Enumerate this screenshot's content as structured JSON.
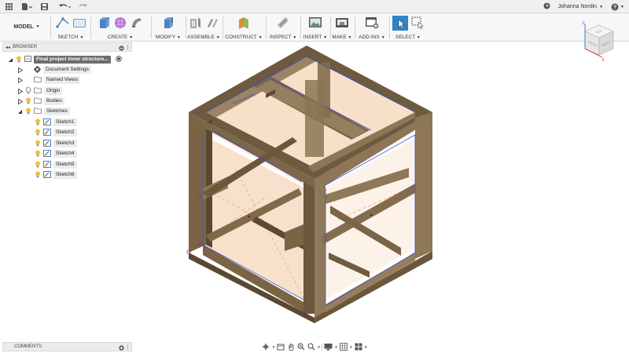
{
  "appbar": {
    "username": "Johanna Nordin",
    "icons": [
      "grid-icon",
      "file-icon",
      "save-icon",
      "undo-icon",
      "redo-icon",
      "clock-icon",
      "help-icon"
    ]
  },
  "toolbar": {
    "workspace": "MODEL",
    "groups": [
      {
        "label": "SKETCH"
      },
      {
        "label": "CREATE"
      },
      {
        "label": "MODIFY"
      },
      {
        "label": "ASSEMBLE"
      },
      {
        "label": "CONSTRUCT"
      },
      {
        "label": "INSPECT"
      },
      {
        "label": "INSERT"
      },
      {
        "label": "MAKE"
      },
      {
        "label": "ADD-INS"
      },
      {
        "label": "SELECT"
      }
    ]
  },
  "browser": {
    "title": "BROWSER",
    "root": "Final project inner structure...",
    "items": [
      {
        "label": "Document Settings"
      },
      {
        "label": "Named Views"
      },
      {
        "label": "Origin"
      },
      {
        "label": "Bodies"
      },
      {
        "label": "Sketches"
      }
    ],
    "sketches": [
      "Sketch1",
      "Sketch2",
      "Sketch3",
      "Sketch4",
      "Sketch5",
      "Sketch6"
    ]
  },
  "comments": {
    "title": "COMMENTS"
  },
  "viewcube": {
    "front": "FRONT",
    "right": "RIGHT",
    "top": "TOP",
    "axis_x": "X",
    "axis_z": "Z"
  }
}
